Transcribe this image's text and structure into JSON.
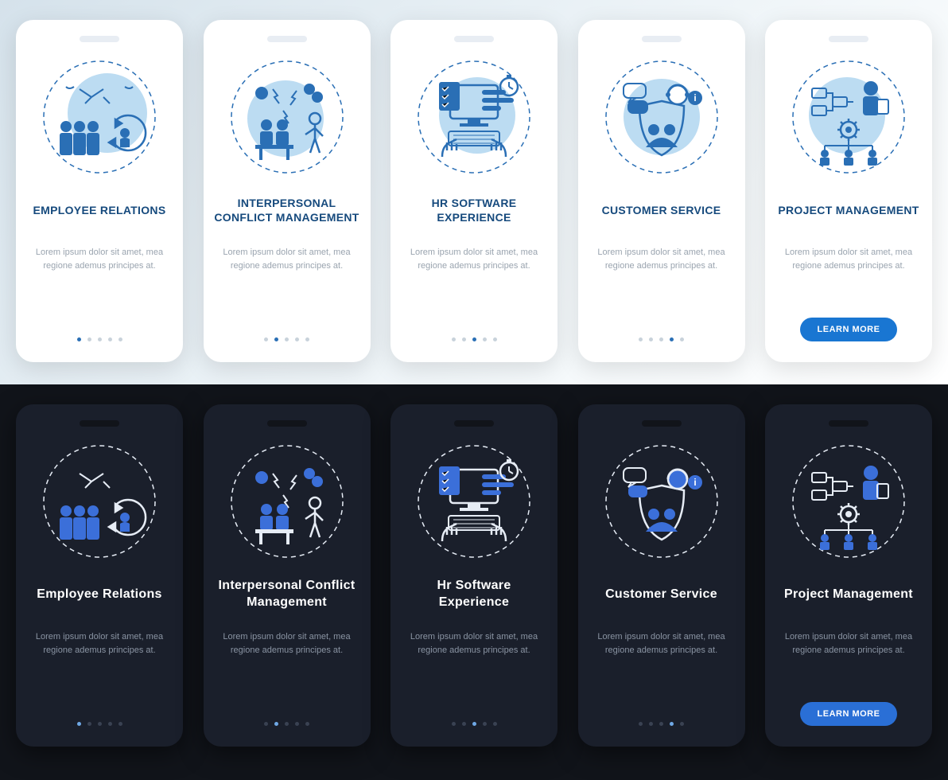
{
  "colors": {
    "accent_light": "#2a6fb5",
    "accent_dark": "#3b6fd9",
    "stroke_light": "#2a6fb5",
    "stroke_dark": "#e6ecf5",
    "fill_dark_accent": "#3b6fd9"
  },
  "lorem": "Lorem ipsum dolor sit amet, mea regione ademus principes at.",
  "learn_more": "LEARN MORE",
  "light": {
    "cards": [
      {
        "title": "EMPLOYEE RELATIONS",
        "active_dot": 0,
        "dots": 5,
        "icon": "employee-relations-icon"
      },
      {
        "title": "INTERPERSONAL CONFLICT MANAGEMENT",
        "active_dot": 1,
        "dots": 5,
        "icon": "conflict-icon"
      },
      {
        "title": "HR SOFTWARE EXPERIENCE",
        "active_dot": 2,
        "dots": 5,
        "icon": "hr-software-icon"
      },
      {
        "title": "CUSTOMER SERVICE",
        "active_dot": 3,
        "dots": 5,
        "icon": "customer-service-icon"
      },
      {
        "title": "PROJECT MANAGEMENT",
        "active_dot": 4,
        "dots": 5,
        "icon": "project-management-icon",
        "cta": true
      }
    ]
  },
  "dark": {
    "cards": [
      {
        "title": "Employee Relations",
        "active_dot": 0,
        "dots": 5,
        "icon": "employee-relations-icon"
      },
      {
        "title": "Interpersonal Conflict Management",
        "active_dot": 1,
        "dots": 5,
        "icon": "conflict-icon"
      },
      {
        "title": "Hr Software Experience",
        "active_dot": 2,
        "dots": 5,
        "icon": "hr-software-icon"
      },
      {
        "title": "Customer Service",
        "active_dot": 3,
        "dots": 5,
        "icon": "customer-service-icon"
      },
      {
        "title": "Project Management",
        "active_dot": 4,
        "dots": 5,
        "icon": "project-management-icon",
        "cta": true
      }
    ]
  }
}
